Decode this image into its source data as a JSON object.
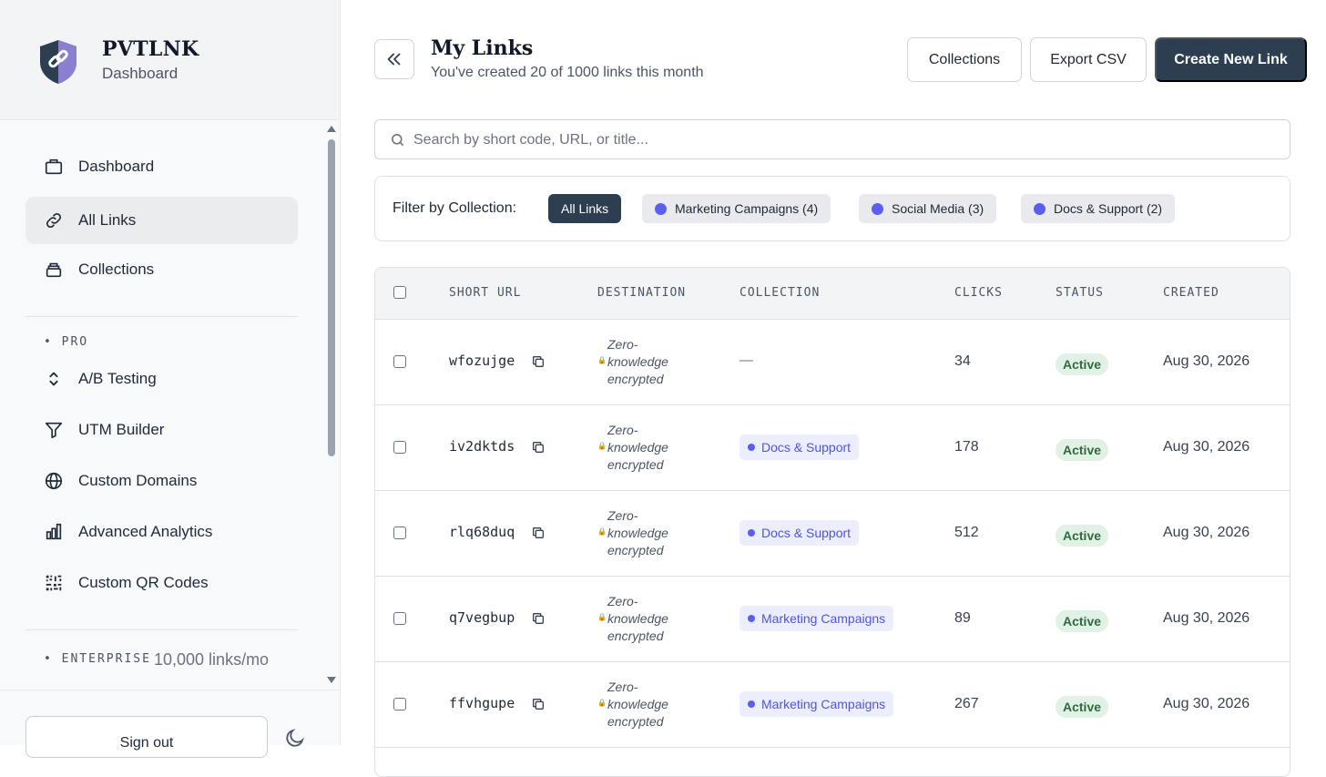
{
  "brand": {
    "name": "PVTLNK",
    "subtitle": "Dashboard"
  },
  "nav": {
    "items": [
      {
        "label": "Dashboard",
        "icon": "briefcase-icon"
      },
      {
        "label": "All Links",
        "icon": "link-icon",
        "active": true
      },
      {
        "label": "Collections",
        "icon": "stack-icon"
      }
    ],
    "pro_label": "PRO",
    "pro_items": [
      {
        "label": "A/B Testing",
        "icon": "chevrons-up-down-icon"
      },
      {
        "label": "UTM Builder",
        "icon": "filter-icon"
      },
      {
        "label": "Custom Domains",
        "icon": "globe-icon"
      },
      {
        "label": "Advanced Analytics",
        "icon": "bar-chart-icon"
      },
      {
        "label": "Custom QR Codes",
        "icon": "qr-code-icon"
      }
    ],
    "enterprise_label": "ENTERPRISE",
    "enterprise_extra": "10,000 links/mo"
  },
  "footer": {
    "signout": "Sign out"
  },
  "header": {
    "title": "My Links",
    "subtitle": "You've created 20 of 1000 links this month",
    "buttons": {
      "collections": "Collections",
      "export": "Export CSV",
      "create": "Create New Link"
    }
  },
  "search": {
    "placeholder": "Search by short code, URL, or title...",
    "value": ""
  },
  "filter": {
    "label": "Filter by Collection:",
    "chips": [
      {
        "label": "All Links",
        "active": true
      },
      {
        "label": "Marketing Campaigns (4)",
        "color": "#5b5ff0"
      },
      {
        "label": "Social Media (3)",
        "color": "#5b5ff0"
      },
      {
        "label": "Docs & Support (2)",
        "color": "#5b5ff0"
      }
    ]
  },
  "table": {
    "columns": [
      "SHORT URL",
      "DESTINATION",
      "COLLECTION",
      "CLICKS",
      "STATUS",
      "CREATED"
    ],
    "rows": [
      {
        "short": "wfozujge",
        "dest": "Zero-knowledge encrypted",
        "collection": "—",
        "clicks": "34",
        "status": "Active",
        "created": "Aug 30, 2026"
      },
      {
        "short": "iv2dktds",
        "dest": "Zero-knowledge encrypted",
        "collection": "Docs & Support",
        "clicks": "178",
        "status": "Active",
        "created": "Aug 30, 2026"
      },
      {
        "short": "rlq68duq",
        "dest": "Zero-knowledge encrypted",
        "collection": "Docs & Support",
        "clicks": "512",
        "status": "Active",
        "created": "Aug 30, 2026"
      },
      {
        "short": "q7vegbup",
        "dest": "Zero-knowledge encrypted",
        "collection": "Marketing Campaigns",
        "clicks": "89",
        "status": "Active",
        "created": "Aug 30, 2026"
      },
      {
        "short": "ffvhgupe",
        "dest": "Zero-knowledge encrypted",
        "collection": "Marketing Campaigns",
        "clicks": "267",
        "status": "Active",
        "created": "Aug 30, 2026"
      }
    ]
  },
  "colors": {
    "primary": "#2c3e50",
    "accent": "#5b5ff0",
    "active_badge": "#2f6b40"
  }
}
